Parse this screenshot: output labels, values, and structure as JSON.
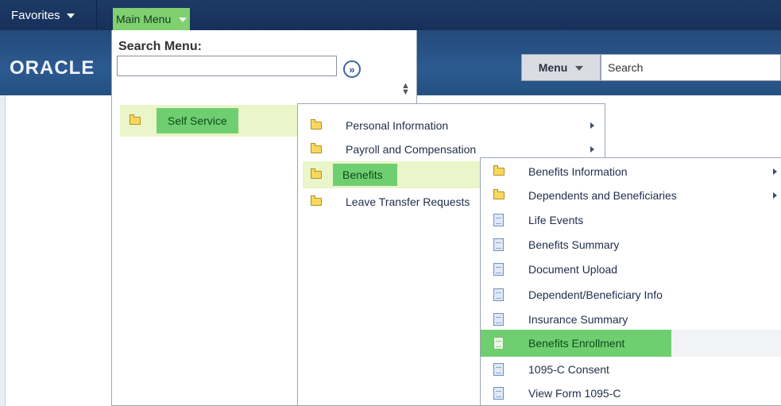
{
  "header": {
    "favorites_label": "Favorites",
    "main_menu_label": "Main Menu",
    "logo_text": "ORACLE",
    "menu_button_label": "Menu",
    "search_placeholder": "Search"
  },
  "main_menu": {
    "search_label": "Search Menu:",
    "search_value": "",
    "go_glyph": "»",
    "items": [
      {
        "label": "Self Service",
        "icon": "folder-icon",
        "highlighted": true
      }
    ]
  },
  "self_service": {
    "items": [
      {
        "label": "Personal Information",
        "icon": "folder-icon",
        "submenu": true
      },
      {
        "label": "Payroll and Compensation",
        "icon": "folder-icon",
        "submenu": true
      },
      {
        "label": "Benefits",
        "icon": "folder-icon",
        "highlighted": true
      },
      {
        "label": "Leave Transfer Requests",
        "icon": "folder-icon"
      }
    ]
  },
  "benefits": {
    "items": [
      {
        "label": "Benefits Information",
        "icon": "folder-icon",
        "submenu": true
      },
      {
        "label": "Dependents and Beneficiaries",
        "icon": "folder-icon",
        "submenu": true
      },
      {
        "label": "Life Events",
        "icon": "document-icon"
      },
      {
        "label": "Benefits Summary",
        "icon": "document-icon"
      },
      {
        "label": "Document Upload",
        "icon": "document-icon"
      },
      {
        "label": "Dependent/Beneficiary Info",
        "icon": "document-icon"
      },
      {
        "label": "Insurance Summary",
        "icon": "document-icon"
      },
      {
        "label": "Benefits Enrollment",
        "icon": "document-icon",
        "highlighted": true
      },
      {
        "label": "1095-C Consent",
        "icon": "document-icon"
      },
      {
        "label": "View Form 1095-C",
        "icon": "document-icon"
      }
    ]
  },
  "colors": {
    "nav_bar": "#1d3a66",
    "banner": "#2c5a90",
    "highlight": "#6fcf70",
    "highlight_row": "#eaf5c9"
  }
}
